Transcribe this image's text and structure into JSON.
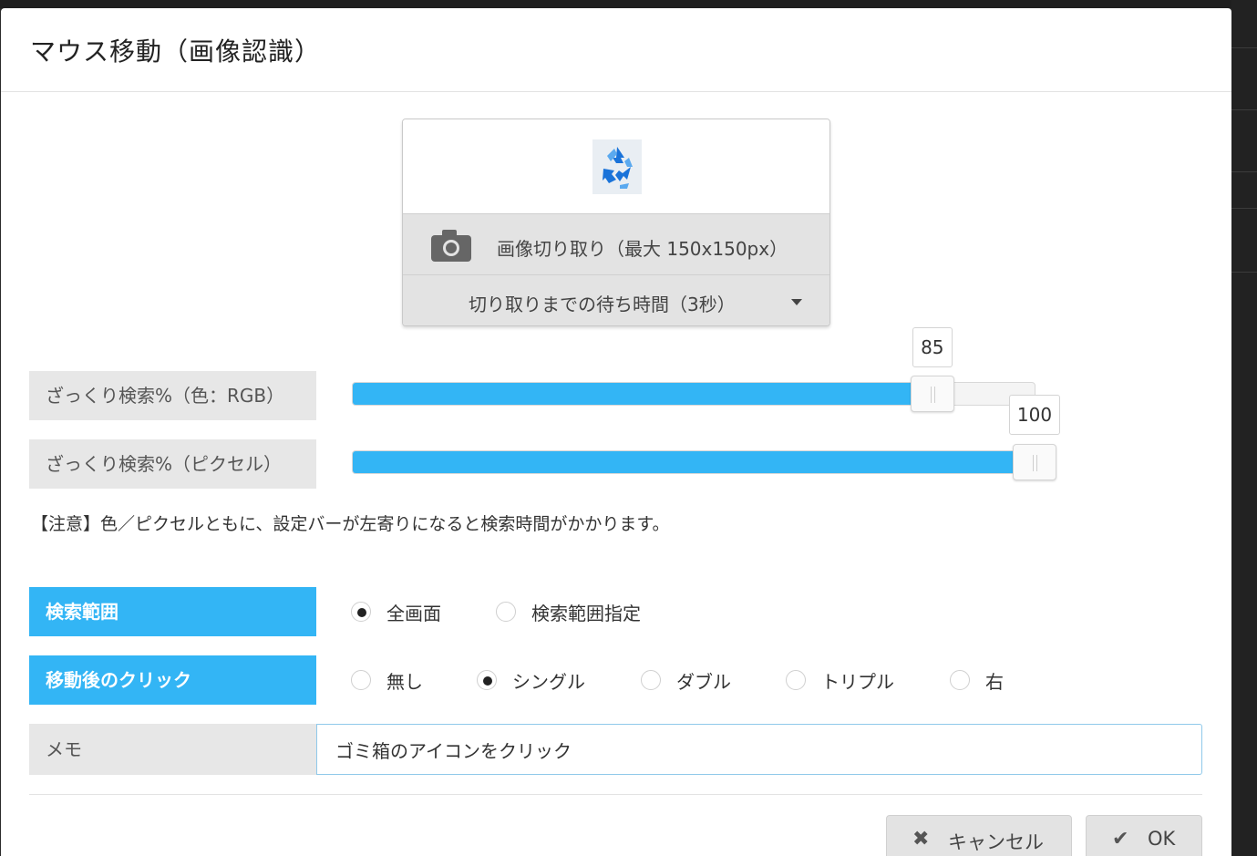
{
  "dialog": {
    "title": "マウス移動（画像認識）"
  },
  "capture": {
    "crop_label": "画像切り取り（最大 150x150px）",
    "wait_label": "切り取りまでの待ち時間（3秒）"
  },
  "sliders": {
    "color": {
      "label": "ざっくり検索%（色：RGB）",
      "value": 85,
      "value_text": "85",
      "max": 100
    },
    "pixel": {
      "label": "ざっくり検索%（ピクセル）",
      "value": 100,
      "value_text": "100",
      "max": 100
    }
  },
  "notice": "【注意】色／ピクセルともに、設定バーが左寄りになると検索時間がかかります。",
  "search_range": {
    "label": "検索範囲",
    "options": [
      "全画面",
      "検索範囲指定"
    ],
    "selected": "全画面"
  },
  "click_after": {
    "label": "移動後のクリック",
    "options": [
      "無し",
      "シングル",
      "ダブル",
      "トリプル",
      "右"
    ],
    "selected": "シングル"
  },
  "memo": {
    "label": "メモ",
    "value": "ゴミ箱のアイコンをクリック"
  },
  "footer": {
    "cancel_label": "キャンセル",
    "ok_label": "OK"
  },
  "colors": {
    "accent": "#33b5f5",
    "label_bg": "#e7e7e7",
    "button_bg": "#e3e3e3"
  },
  "icons": {
    "thumbnail": "recycle-bin-icon",
    "crop": "camera-icon",
    "wait": "caret-down-icon",
    "cancel": "close-icon",
    "ok": "check-icon"
  }
}
